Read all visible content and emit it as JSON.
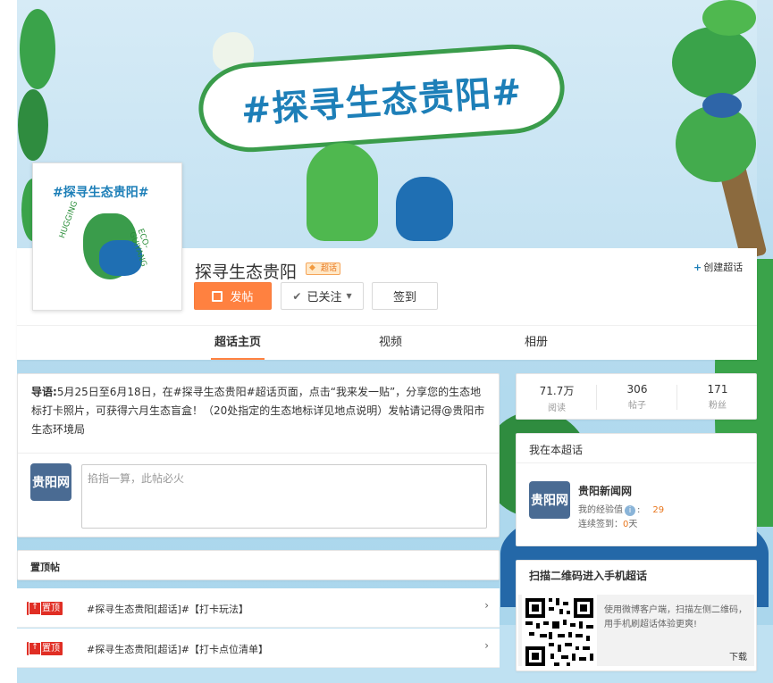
{
  "banner": {
    "hashtag": "#探寻生态贵阳#"
  },
  "avatar": {
    "title": "#探寻生态贵阳#",
    "side_left": "HUGGING",
    "side_right": "ECO-GUIYANG"
  },
  "topic": {
    "name": "探寻生态贵阳",
    "badge": "超话",
    "create_label": "创建超话",
    "post_label": "发帖",
    "follow_label": "已关注",
    "sign_label": "签到"
  },
  "tabs": [
    {
      "label": "超话主页",
      "active": true
    },
    {
      "label": "视频",
      "active": false
    },
    {
      "label": "相册",
      "active": false
    }
  ],
  "intro": {
    "lead": "导语:",
    "text": "5月25日至6月18日，在#探寻生态贵阳#超话页面，点击“我来发一贴”，分享您的生态地标打卡照片，可获得六月生态盲盒！（20处指定的生态地标详见地点说明）发帖请记得@贵阳市生态环境局",
    "composer_avatar": "贵阳网",
    "composer_placeholder": "掐指一算，此帖必火"
  },
  "pinned": {
    "title": "置顶帖",
    "tag": "置顶",
    "items": [
      {
        "text": "#探寻生态贵阳[超话]#【打卡玩法】"
      },
      {
        "text": "#探寻生态贵阳[超话]#【打卡点位清单】"
      }
    ]
  },
  "stats": [
    {
      "value": "71.7万",
      "label": "阅读"
    },
    {
      "value": "306",
      "label": "帖子"
    },
    {
      "value": "171",
      "label": "粉丝"
    }
  ],
  "me": {
    "title": "我在本超话",
    "avatar": "贵阳网",
    "name": "贵阳新闻网",
    "exp_label": "我的经验值",
    "exp_value": "29",
    "sign_label": "连续签到：",
    "sign_value": "0",
    "sign_unit": "天"
  },
  "qr": {
    "title": "扫描二维码进入手机超话",
    "desc": "使用微博客户端，扫描左侧二维码，用手机刷超话体验更爽!",
    "download": "下载"
  },
  "colors": {
    "accent": "#ff8140",
    "link_blue": "#1d7fb8",
    "pin_red": "#e02e24",
    "eco_green": "#3a9c4b"
  }
}
